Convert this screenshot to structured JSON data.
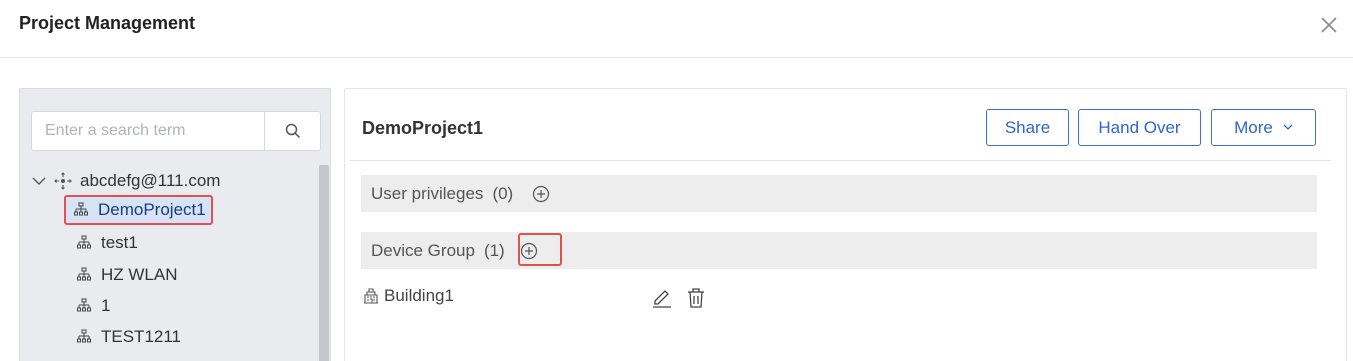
{
  "dialog": {
    "title": "Project Management",
    "close_icon": "close-icon"
  },
  "tree": {
    "search": {
      "placeholder": "Enter a search term",
      "icon": "search-icon"
    },
    "root": {
      "label": "abcdefg@111.com",
      "expanded": true,
      "icon": "tenant-icon"
    },
    "children": [
      {
        "label": "DemoProject1",
        "selected": true,
        "icon": "project-icon"
      },
      {
        "label": "test1",
        "icon": "project-icon"
      },
      {
        "label": "HZ WLAN",
        "icon": "project-icon"
      },
      {
        "label": "1",
        "icon": "project-icon"
      },
      {
        "label": "TEST1211",
        "icon": "project-icon"
      }
    ]
  },
  "project": {
    "name": "DemoProject1",
    "actions": {
      "share": "Share",
      "hand_over": "Hand Over",
      "more": "More"
    },
    "user_privileges": {
      "label": "User privileges",
      "count": "(0)"
    },
    "device_group": {
      "label": "Device Group",
      "count": "(1)"
    },
    "devices": [
      {
        "name": "Building1",
        "icon": "building-icon"
      }
    ]
  },
  "colors": {
    "accent": "#2f66c9",
    "highlight": "#e05252",
    "selected_bg": "#d6e2f6"
  }
}
